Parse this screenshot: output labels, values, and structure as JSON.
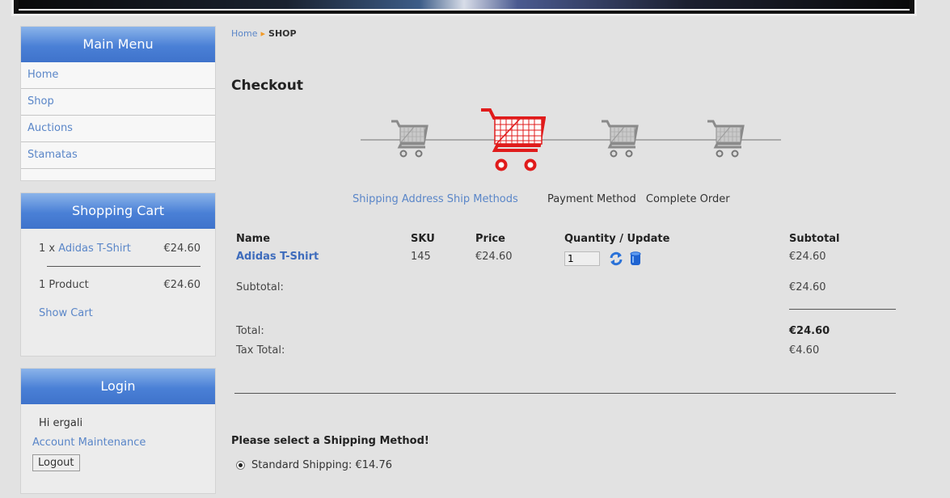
{
  "sidebar": {
    "main_menu": {
      "title": "Main Menu",
      "items": [
        "Home",
        "Shop",
        "Auctions",
        "Stamatas"
      ]
    },
    "cart": {
      "title": "Shopping Cart",
      "item_qty": "1 x",
      "item_name": "Adidas T-Shirt",
      "item_price": "€24.60",
      "summary_label": "1 Product",
      "summary_price": "€24.60",
      "show_cart": "Show Cart"
    },
    "login": {
      "title": "Login",
      "greeting": "Hi ergali",
      "account": "Account Maintenance",
      "logout": "Logout"
    }
  },
  "breadcrumb": {
    "home": "Home",
    "separator": "▸",
    "current": "SHOP"
  },
  "page_title": "Checkout",
  "steps": {
    "labels": [
      "Shipping Address",
      "Ship Methods",
      "Payment Method",
      "Complete Order"
    ],
    "active_index": 1,
    "active_color": "#e01b1b",
    "inactive_color": "#888888"
  },
  "table": {
    "headers": {
      "name": "Name",
      "sku": "SKU",
      "price": "Price",
      "qty": "Quantity / Update",
      "subtotal": "Subtotal"
    },
    "row": {
      "name": "Adidas T-Shirt",
      "sku": "145",
      "price": "€24.60",
      "qty": "1",
      "subtotal": "€24.60"
    },
    "subtotal_label": "Subtotal:",
    "subtotal_value": "€24.60",
    "total_label": "Total:",
    "total_value": "€24.60",
    "tax_label": "Tax Total:",
    "tax_value": "€4.60"
  },
  "shipping": {
    "title": "Please select a Shipping Method!",
    "option": "Standard Shipping: €14.76"
  }
}
